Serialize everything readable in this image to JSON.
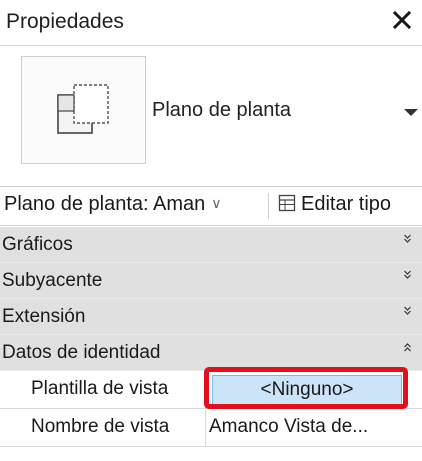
{
  "panel": {
    "title": "Propiedades",
    "close_icon": "close-icon"
  },
  "type_selector": {
    "thumbnail_icon": "floor-plan-icon",
    "type_name": "Plano de planta",
    "dropdown_icon": "dropdown-arrow-icon"
  },
  "instance_row": {
    "selector_label": "Plano de planta: Aman",
    "edit_type_label": "Editar tipo",
    "edit_type_icon": "edit-type-icon"
  },
  "groups": [
    {
      "name": "Gráficos",
      "state": "collapsed"
    },
    {
      "name": "Subyacente",
      "state": "collapsed"
    },
    {
      "name": "Extensión",
      "state": "collapsed"
    },
    {
      "name": "Datos de identidad",
      "state": "expanded"
    }
  ],
  "properties": [
    {
      "label": "Plantilla de vista",
      "value": "<Ninguno>",
      "highlighted": true
    },
    {
      "label": "Nombre de vista",
      "value": "Amanco Vista de..."
    }
  ],
  "colors": {
    "group_header_bg": "#e0e0e0",
    "highlight_border": "#e3101b",
    "selected_value_bg": "#cce4f7"
  }
}
